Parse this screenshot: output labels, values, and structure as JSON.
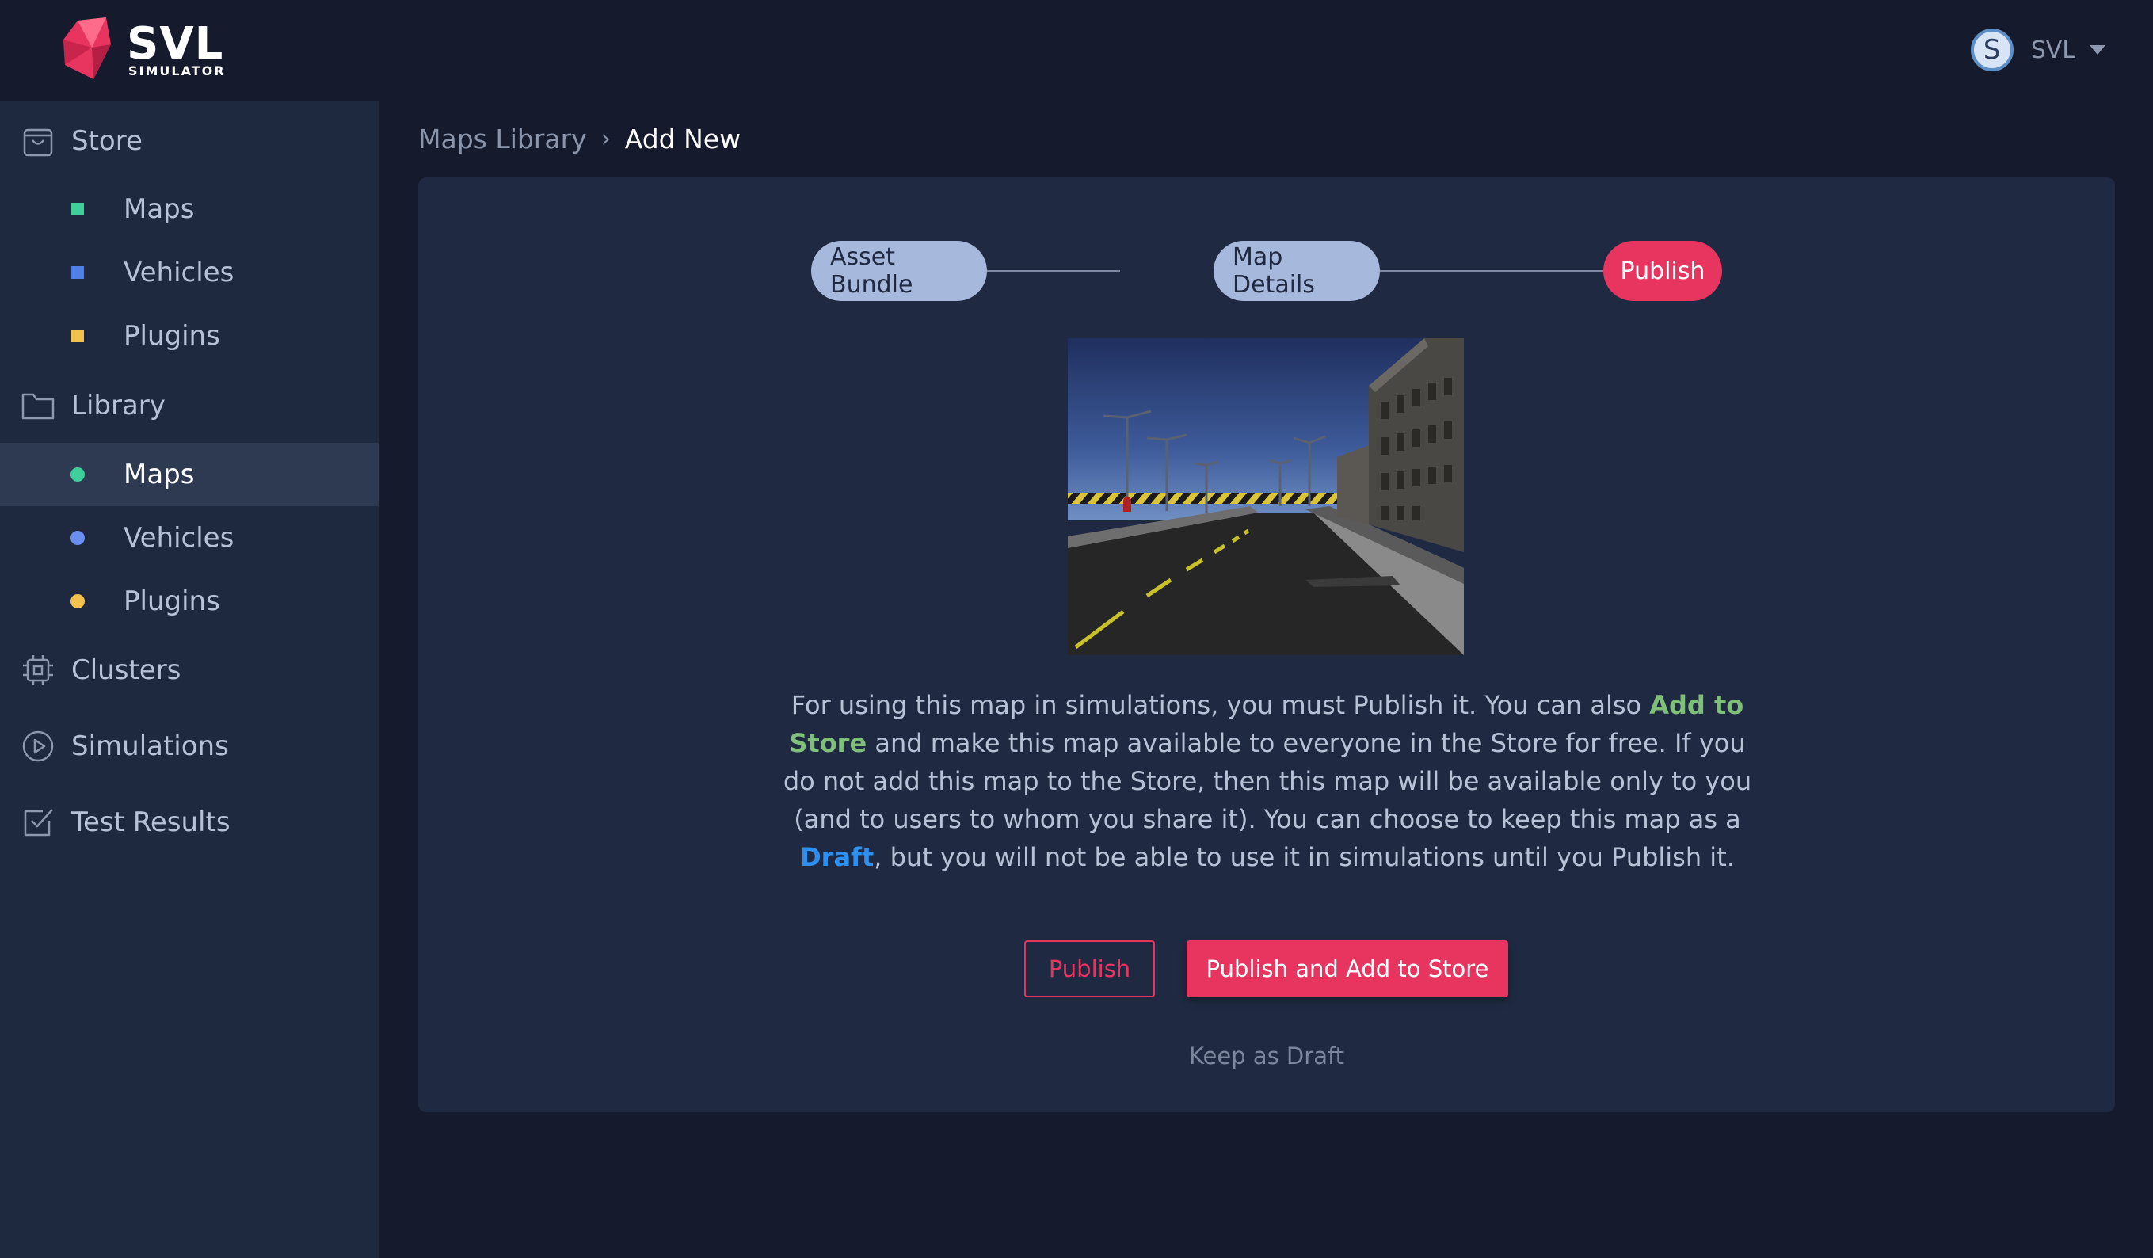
{
  "brand": {
    "name": "SVL",
    "subtitle": "SIMULATOR"
  },
  "user": {
    "initial": "S",
    "name": "SVL"
  },
  "sidebar": {
    "store": {
      "label": "Store",
      "items": [
        {
          "label": "Maps",
          "color": "#3ecf9a"
        },
        {
          "label": "Vehicles",
          "color": "#4f7fe8"
        },
        {
          "label": "Plugins",
          "color": "#f2c14e"
        }
      ]
    },
    "library": {
      "label": "Library",
      "items": [
        {
          "label": "Maps",
          "color": "#3ecf9a",
          "active": true
        },
        {
          "label": "Vehicles",
          "color": "#6b8ff0"
        },
        {
          "label": "Plugins",
          "color": "#f2c14e"
        }
      ]
    },
    "clusters": {
      "label": "Clusters"
    },
    "simulations": {
      "label": "Simulations"
    },
    "test_results": {
      "label": "Test Results"
    }
  },
  "breadcrumb": {
    "parent": "Maps Library",
    "separator": "›",
    "current": "Add New"
  },
  "stepper": {
    "steps": [
      {
        "label": "Asset Bundle",
        "state": "done"
      },
      {
        "label": "Map Details",
        "state": "done"
      },
      {
        "label": "Publish",
        "state": "current"
      }
    ]
  },
  "info": {
    "part1": "For using this map in simulations, you must Publish it. You can also ",
    "add_to_store": "Add to Store",
    "part2": " and make this map available to everyone in the Store for free. If you do not add this map to the Store, then this map will be available only to you (and to users to whom you share it). You can choose to keep this map as a ",
    "draft": "Draft",
    "part3": ", but you will not be able to use it in simulations until you Publish it."
  },
  "actions": {
    "publish": "Publish",
    "publish_and_add": "Publish and Add to Store",
    "keep_draft": "Keep as Draft"
  },
  "colors": {
    "accent": "#e8355f",
    "step_done": "#a6b8db",
    "green_highlight": "#7fbf7a",
    "blue_highlight": "#2d8ff0"
  }
}
